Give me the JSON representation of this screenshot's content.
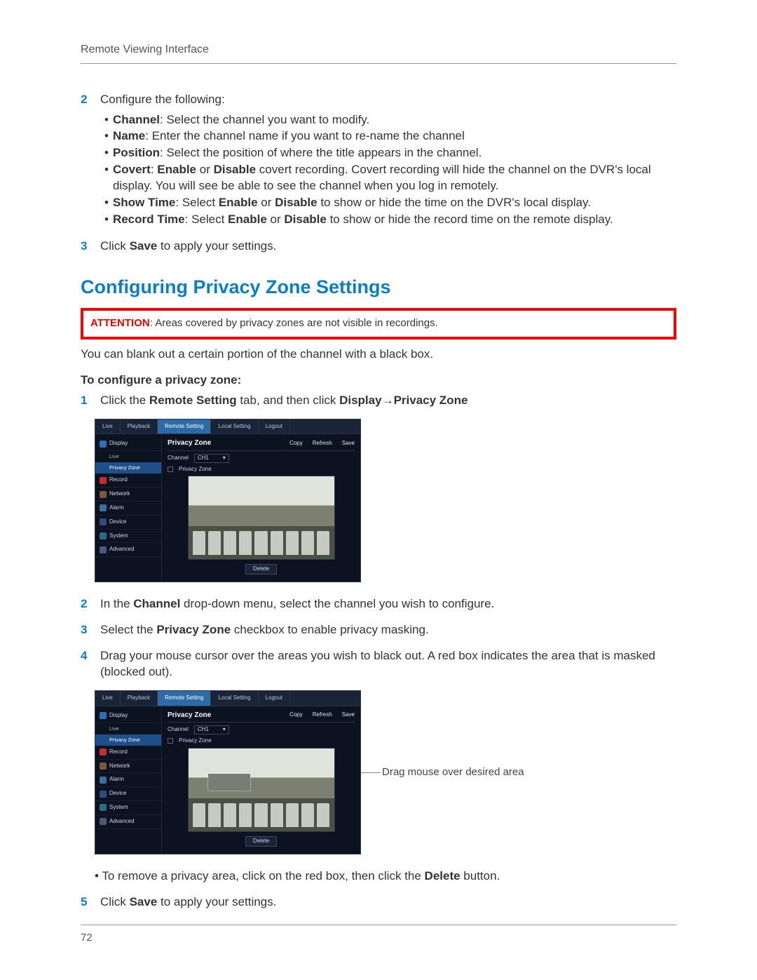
{
  "header": {
    "title": "Remote Viewing Interface"
  },
  "step2": {
    "num": "2",
    "lead": "Configure the following:",
    "bullets": [
      {
        "label": "Channel",
        "sep": ": ",
        "text": "Select the channel you want to modify."
      },
      {
        "label": "Name",
        "sep": ": ",
        "text": "Enter the channel name if you want to re-name the channel"
      },
      {
        "label": "Position",
        "sep": ": ",
        "text": "Select the position of where the title appears in the channel."
      },
      {
        "label": "Covert",
        "sep": ": ",
        "text_before": "",
        "bold1": "Enable",
        "mid": " or ",
        "bold2": "Disable",
        "text_after": " covert recording. Covert recording will hide the channel on the DVR's local display. You will see be able to see the channel when you log in remotely."
      },
      {
        "label": "Show Time",
        "sep": ": Select ",
        "bold1": "Enable",
        "mid": " or ",
        "bold2": "Disable",
        "text_after": " to show or hide the time on the DVR's local display."
      },
      {
        "label": "Record Time",
        "sep": ": Select ",
        "bold1": "Enable",
        "mid": " or ",
        "bold2": "Disable",
        "text_after": " to show or hide the record time on the remote display."
      }
    ]
  },
  "step3": {
    "num": "3",
    "pre": "Click ",
    "bold": "Save",
    "post": " to apply your settings."
  },
  "section_heading": "Configuring Privacy Zone Settings",
  "attention": {
    "label": "ATTENTION",
    "sep": ": ",
    "text": "Areas covered by privacy zones are not visible in recordings."
  },
  "privacy_intro": "You can blank out a certain portion of the channel with a black box.",
  "privacy_sub_head": "To configure a privacy zone:",
  "pstep1": {
    "num": "1",
    "pre": "Click the ",
    "b1": "Remote Setting",
    "mid1": " tab, and then click ",
    "b2": "Display",
    "arrow": "→",
    "b3": "Privacy Zone"
  },
  "dvr": {
    "tabs": [
      "Live",
      "Playback",
      "Remote Setting",
      "Local Setting",
      "Logout"
    ],
    "active_tab_index": 2,
    "side": [
      {
        "label": "Display",
        "color": "#2f6fb5",
        "subs": [
          "Live",
          "Privacy Zone"
        ],
        "active_sub": 1
      },
      {
        "label": "Record",
        "color": "#c03030"
      },
      {
        "label": "Network",
        "color": "#7a5a3a"
      },
      {
        "label": "Alarm",
        "color": "#3a6fa0"
      },
      {
        "label": "Device",
        "color": "#304a80"
      },
      {
        "label": "System",
        "color": "#2e6a88"
      },
      {
        "label": "Advanced",
        "color": "#4a5a7a"
      }
    ],
    "panel_title": "Privacy Zone",
    "panel_buttons": [
      "Copy",
      "Refresh",
      "Save"
    ],
    "channel_label": "Channel",
    "channel_value": "CH1",
    "checkbox_label": "Privacy Zone",
    "delete_label": "Delete"
  },
  "pstep2": {
    "num": "2",
    "pre": "In the ",
    "b1": "Channel",
    "post": " drop-down menu, select the channel you wish to configure."
  },
  "pstep3": {
    "num": "3",
    "pre": "Select the ",
    "b1": "Privacy Zone",
    "post": " checkbox to enable privacy masking."
  },
  "pstep4": {
    "num": "4",
    "text": "Drag your mouse cursor over the areas you wish to black out. A red box indicates the area that is masked (blocked out)."
  },
  "callout": "Drag mouse over desired area",
  "remove_line": {
    "bullet": "• ",
    "pre": "To remove a privacy area, click on the red box, then click the ",
    "b1": "Delete",
    "post": " button."
  },
  "pstep5": {
    "num": "5",
    "pre": "Click ",
    "b1": "Save",
    "post": " to apply your settings."
  },
  "page_number": "72"
}
